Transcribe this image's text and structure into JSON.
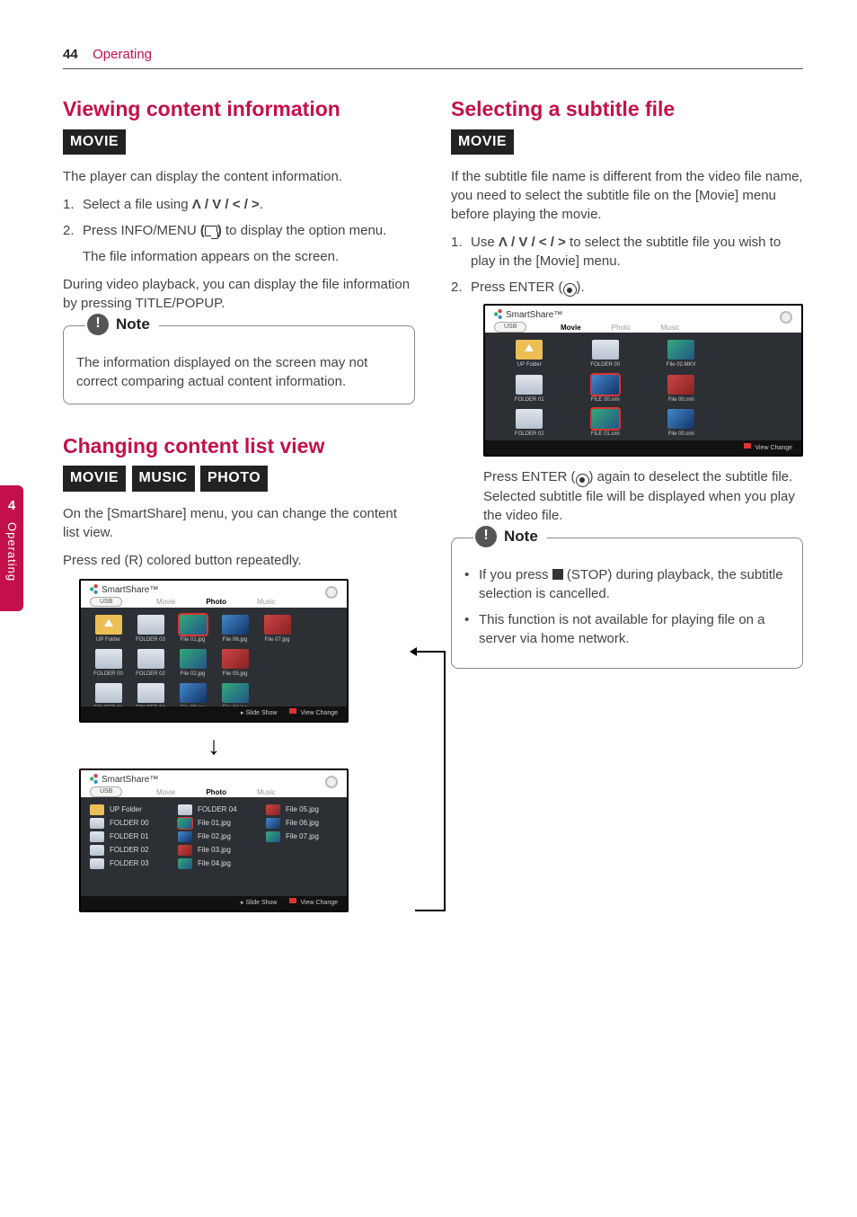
{
  "page_number": "44",
  "breadcrumb": "Operating",
  "side_tab": {
    "number": "4",
    "label": "Operating"
  },
  "sections": {
    "viewing": {
      "title": "Viewing content information",
      "tags": [
        "MOVIE"
      ],
      "intro": "The player can display the content information.",
      "step1_a": "Select a file using ",
      "step1_nav": "Λ / V / < / >",
      "step1_b": ".",
      "step2_a": "Press INFO/MENU ",
      "step2_paren_open": "(",
      "step2_paren_close": ")",
      "step2_b": " to display the option menu.",
      "step2_sub": "The file information appears on the screen.",
      "after": "During video playback, you can display the file information by pressing TITLE/POPUP.",
      "note_label": "Note",
      "note_body": "The information displayed on the screen may not correct comparing actual content information."
    },
    "changing": {
      "title": "Changing content list view",
      "tags": [
        "MOVIE",
        "MUSIC",
        "PHOTO"
      ],
      "intro": "On the [SmartShare] menu, you can change the content list view.",
      "body2": "Press red (R) colored button repeatedly."
    },
    "selecting": {
      "title": "Selecting a subtitle file",
      "tags": [
        "MOVIE"
      ],
      "intro": "If the subtitle file name is different from the video file name, you need to select the subtitle file on the [Movie] menu before playing the movie.",
      "step1_a": "Use ",
      "step1_nav": "Λ / V / < / >",
      "step1_b": " to select the subtitle file you wish to play in the [Movie] menu.",
      "step2_a": "Press ENTER (",
      "step2_b": ").",
      "after_a": "Press ENTER (",
      "after_b": ") again to deselect the subtitle file. Selected subtitle file will be displayed when you play the video file.",
      "note_label": "Note",
      "note1_a": "If you press ",
      "note1_b": " (STOP) during playback, the subtitle selection is cancelled.",
      "note2": "This function is not available for playing file on a server via home network."
    }
  },
  "screenshots": {
    "brand": "SmartShare™",
    "usb": "USB",
    "tabs_photo": {
      "movie": "Movie",
      "photo": "Photo",
      "music": "Music"
    },
    "tabs_movie": {
      "movie": "Movie",
      "photo": "Photo",
      "music": "Music"
    },
    "grid": {
      "up": "UP Folder",
      "f00": "FOLDER 00",
      "f01": "FOLDER 01",
      "f02": "FOLDER 02",
      "f03": "FOLDER 03",
      "f04": "FOLDER 04",
      "i01": "File 01.jpg",
      "i02": "File 02.jpg",
      "i03": "File 03.jpg",
      "i04": "File 04.jpg",
      "i05": "File 05.jpg",
      "i06": "File 06.jpg",
      "i07": "File 07.jpg"
    },
    "movie_grid": {
      "up": "UP Folder",
      "f00": "FOLDER 00",
      "f01": "FOLDER 01",
      "f02": "FOLDER 02",
      "m00": "File 02.MKV",
      "s00": "FILE 00.smi",
      "s01": "File 00.smi",
      "s10": "FILE 01.smi",
      "s11": "File 00.smi"
    },
    "footer_slide": "Slide Show",
    "footer_view": "View Change"
  }
}
